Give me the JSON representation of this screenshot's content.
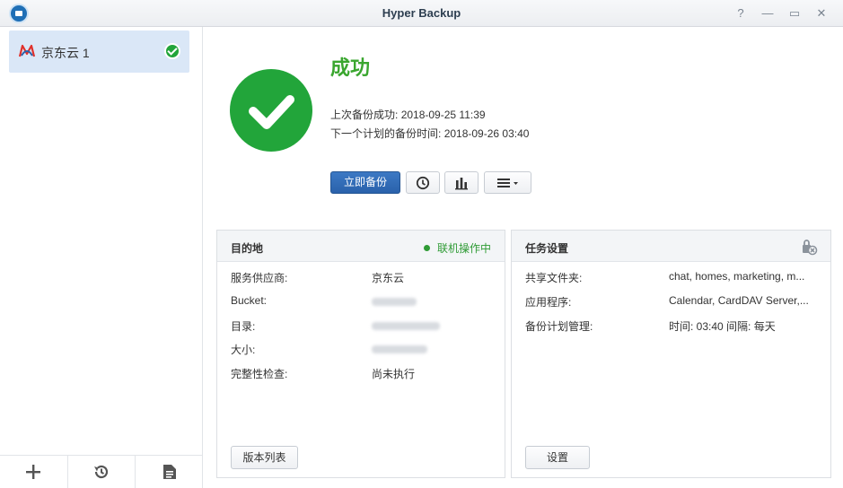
{
  "window": {
    "title": "Hyper Backup",
    "controls": {
      "help": "?",
      "minimize": "—",
      "maximize": "▭",
      "close": "✕"
    }
  },
  "sidebar": {
    "tasks": [
      {
        "label": "京东云 1",
        "status": "success",
        "selected": true
      }
    ],
    "footer": [
      {
        "icon": "plus-icon"
      },
      {
        "icon": "restore-history-icon"
      },
      {
        "icon": "log-document-icon"
      }
    ]
  },
  "status": {
    "title": "成功",
    "last_backup_label": "上次备份成功:",
    "last_backup_time": "2018-09-25 11:39",
    "next_backup_label": "下一个计划的备份时间:",
    "next_backup_time": "2018-09-26 03:40"
  },
  "actions": {
    "backup_now": "立即备份",
    "icons": [
      "clock-icon",
      "bar-chart-icon",
      "menu-icon"
    ]
  },
  "destination": {
    "title": "目的地",
    "online_status": "联机操作中",
    "rows": [
      {
        "label": "服务供应商:",
        "value": "京东云"
      },
      {
        "label": "Bucket:",
        "value": ""
      },
      {
        "label": "目录:",
        "value": ""
      },
      {
        "label": "大小:",
        "value": ""
      },
      {
        "label": "完整性检查:",
        "value": "尚未执行"
      }
    ],
    "button": "版本列表"
  },
  "task_settings": {
    "title": "任务设置",
    "rows": [
      {
        "label": "共享文件夹:",
        "value": "chat, homes, marketing, m..."
      },
      {
        "label": "应用程序:",
        "value": "Calendar, CardDAV Server,..."
      },
      {
        "label": "备份计划管理:",
        "value": "时间: 03:40 间隔: 每天"
      }
    ],
    "button": "设置"
  },
  "colors": {
    "success": "#22a53a",
    "primary": "#2a62ab",
    "selection": "#dae7f7"
  }
}
